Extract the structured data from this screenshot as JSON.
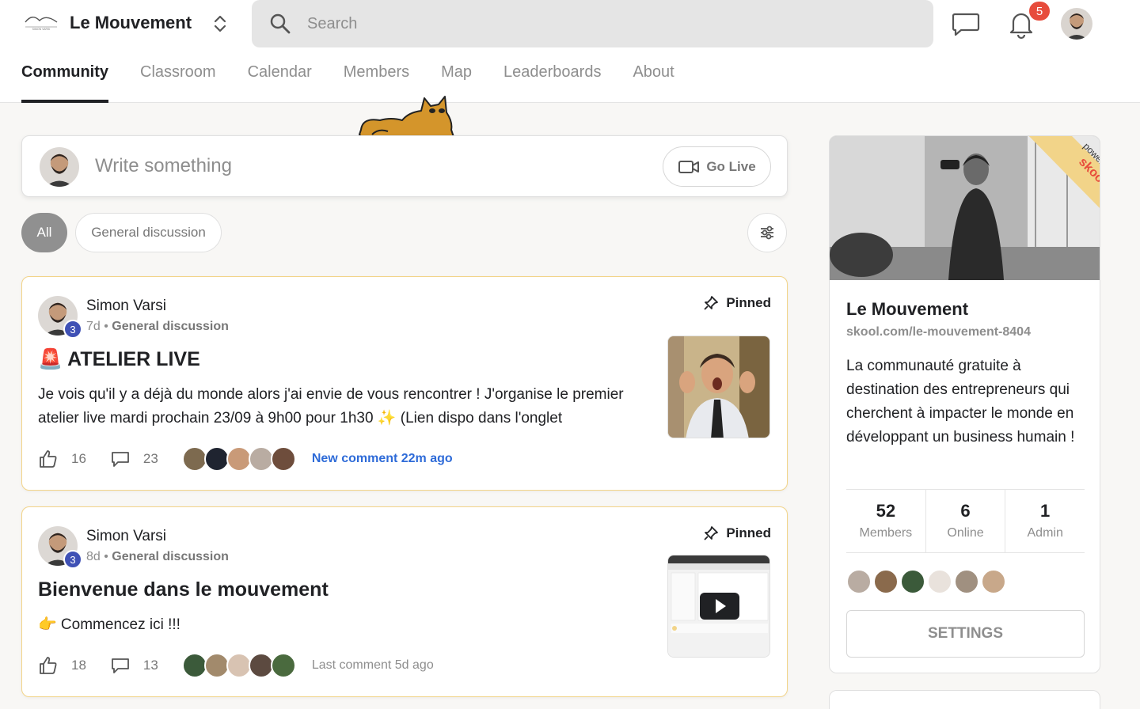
{
  "header": {
    "brand_name": "Le Mouvement",
    "search_placeholder": "Search",
    "notification_count": "5"
  },
  "tabs": [
    {
      "label": "Community",
      "active": true
    },
    {
      "label": "Classroom"
    },
    {
      "label": "Calendar"
    },
    {
      "label": "Members"
    },
    {
      "label": "Map"
    },
    {
      "label": "Leaderboards"
    },
    {
      "label": "About"
    }
  ],
  "composer": {
    "placeholder": "Write something",
    "go_live_label": "Go Live"
  },
  "filters": {
    "all_label": "All",
    "general_label": "General discussion"
  },
  "posts": [
    {
      "author": "Simon Varsi",
      "level": "3",
      "age": "7d",
      "category": "General discussion",
      "pinned_label": "Pinned",
      "title": "🚨 ATELIER LIVE",
      "body": "Je vois qu'il y a déjà du monde alors j'ai envie de vous rencontrer ! J'organise le premier atelier live mardi prochain 23/09 à 9h00 pour 1h30 ✨ (Lien dispo dans l'onglet",
      "likes": "16",
      "comments": "23",
      "comment_status": "New comment 22m ago"
    },
    {
      "author": "Simon Varsi",
      "level": "3",
      "age": "8d",
      "category": "General discussion",
      "pinned_label": "Pinned",
      "title": "Bienvenue dans le mouvement",
      "body": "👉 Commencez ici !!!",
      "likes": "18",
      "comments": "13",
      "comment_status": "Last comment 5d ago"
    }
  ],
  "sidebar": {
    "name": "Le Mouvement",
    "url": "skool.com/le-mouvement-8404",
    "description": "La communauté gratuite à destination des entrepreneurs qui cherchent à impacter le monde en développant un business humain !",
    "stats": [
      {
        "value": "52",
        "label": "Members"
      },
      {
        "value": "6",
        "label": "Online"
      },
      {
        "value": "1",
        "label": "Admin"
      }
    ],
    "settings_label": "SETTINGS",
    "ribbon_text": "powered by",
    "ribbon_brand": "skool"
  },
  "colors": {
    "accent_blue": "#2e6bd8",
    "pinned_border": "#f2d489",
    "badge_red": "#e74c3c",
    "level_blue": "#3f51b5"
  }
}
